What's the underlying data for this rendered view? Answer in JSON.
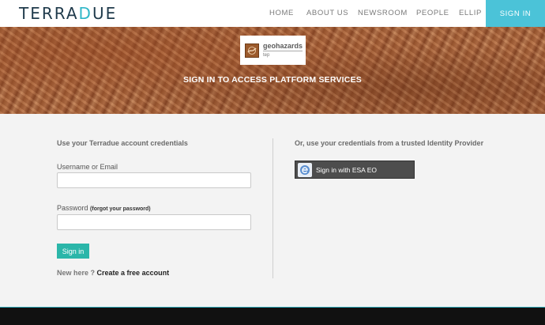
{
  "brand": {
    "logo_main": "TERRA",
    "logo_accent": "D",
    "logo_end": "UE"
  },
  "nav": {
    "items": [
      {
        "label": "HOME"
      },
      {
        "label": "ABOUT US"
      },
      {
        "label": "NEWSROOM"
      },
      {
        "label": "PEOPLE"
      },
      {
        "label": "ELLIP"
      }
    ],
    "signin": "SIGN IN"
  },
  "banner": {
    "badge_title": "geohazards",
    "badge_sub": "tep",
    "title": "SIGN IN TO ACCESS PLATFORM SERVICES"
  },
  "login": {
    "heading": "Use your Terradue account credentials",
    "username_label": "Username or Email",
    "username_value": "",
    "password_label": "Password",
    "forgot_label": "(forgot your password)",
    "password_value": "",
    "submit": "Sign in",
    "new_here": "New here ?",
    "create_account": "Create a free account"
  },
  "idp": {
    "heading": "Or, use your credentials from a trusted Identity Provider",
    "esa_button": "Sign in with ESA EO"
  },
  "colors": {
    "accent": "#4bc3d8",
    "button": "#2bb6a9",
    "footer": "#111111"
  },
  "icons": {
    "badge": "geohazards-logo-icon",
    "esa": "esa-eo-icon"
  }
}
